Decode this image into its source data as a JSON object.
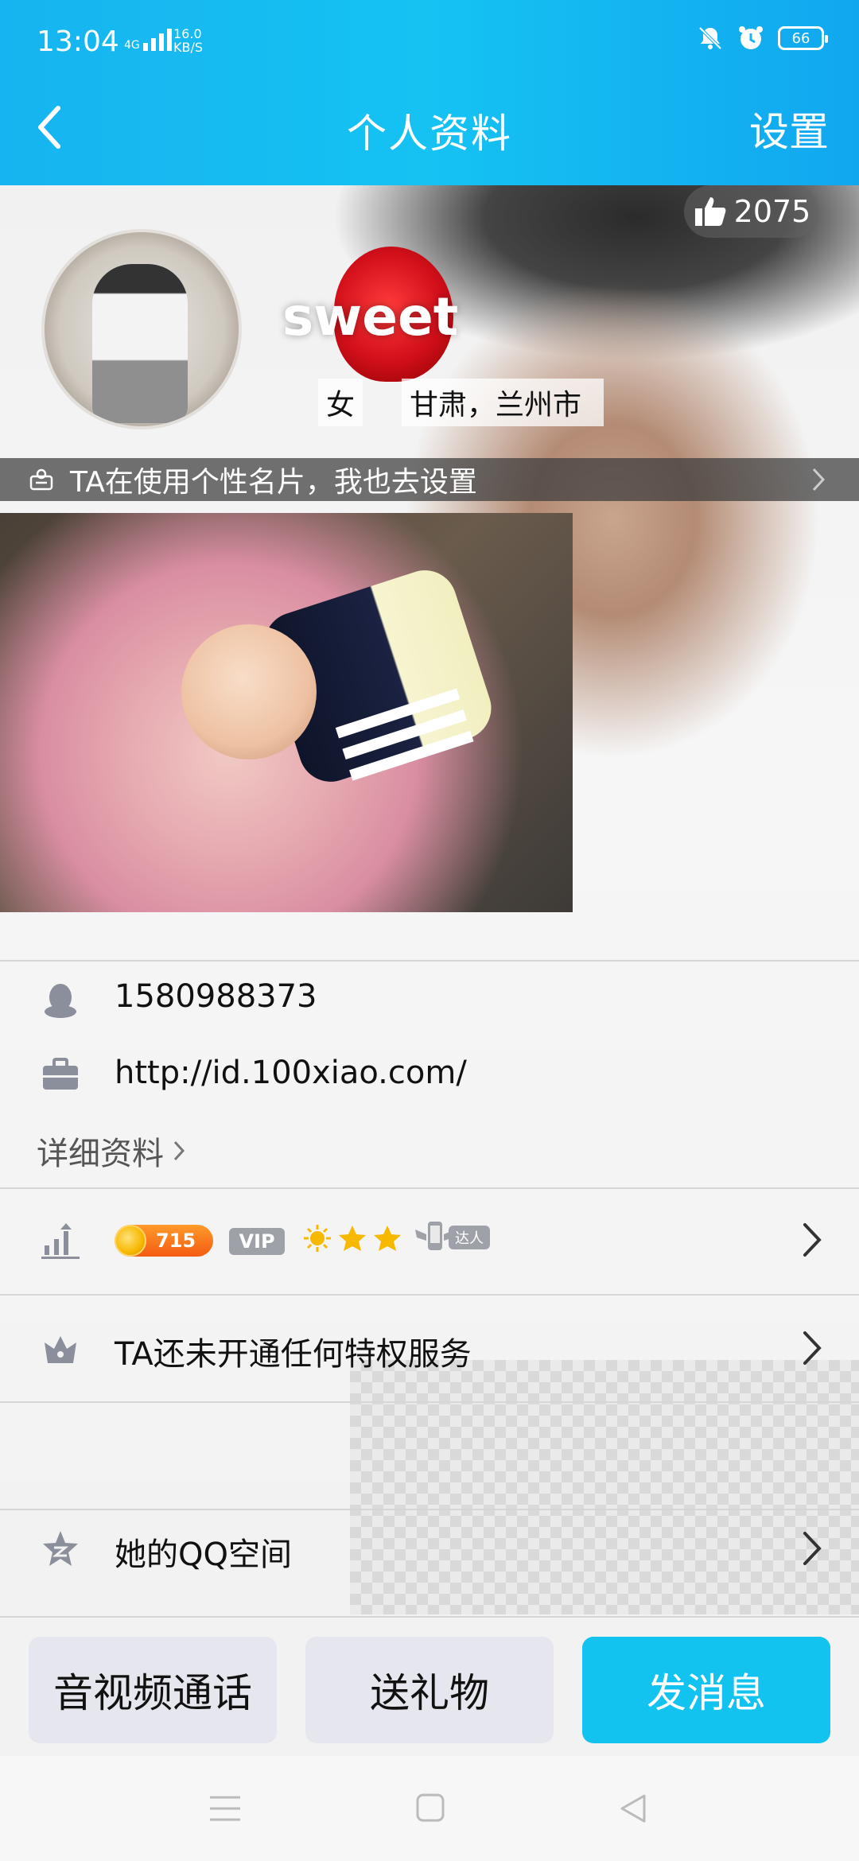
{
  "status_bar": {
    "time": "13:04",
    "network": "4G",
    "speed_value": "16.0",
    "speed_unit": "KB/S",
    "battery": "66"
  },
  "nav": {
    "title": "个人资料",
    "settings": "设置"
  },
  "profile": {
    "likes": "2075",
    "nickname": "sweet",
    "gender": "女",
    "location": "甘肃，兰州市",
    "card_banner": "TA在使用个性名片，我也去设置"
  },
  "info": {
    "qq_number": "1580988373",
    "url": "http://id.100xiao.com/",
    "detail_link": "详细资料"
  },
  "level": {
    "coin_value": "715",
    "vip_label": "VIP",
    "daren_label": "达人"
  },
  "privilege": {
    "text": "TA还未开通任何特权服务"
  },
  "qzone": {
    "text": "她的QQ空间"
  },
  "buttons": {
    "call": "音视频通话",
    "gift": "送礼物",
    "message": "发消息"
  },
  "colors": {
    "accent": "#12c2ef",
    "header": "#16b4f0",
    "secondary_button": "#e6e7ee",
    "icon_gray": "#8b8f9c"
  }
}
